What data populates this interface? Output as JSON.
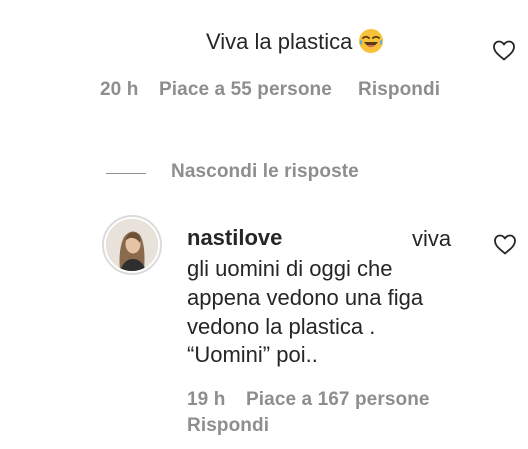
{
  "top_comment": {
    "text": "Viva la plastica",
    "emoji_icon": "face-with-tears-of-joy",
    "time": "20 h",
    "likes": "Piace a 55 persone",
    "reply_label": "Rispondi"
  },
  "replies_toggle": {
    "label": "Nascondi le risposte"
  },
  "reply": {
    "username": "nastilove",
    "lines": [
      "viva",
      "gli uomini di oggi che",
      "appena vedono una figa",
      "vedono la plastica .",
      "“Uomini” poi.."
    ],
    "time": "19 h",
    "likes": "Piace a 167 persone",
    "reply_label": "Rispondi"
  },
  "colors": {
    "text": "#262626",
    "muted": "#8e8e8e",
    "avatar_ring": "#dbdbdb"
  }
}
